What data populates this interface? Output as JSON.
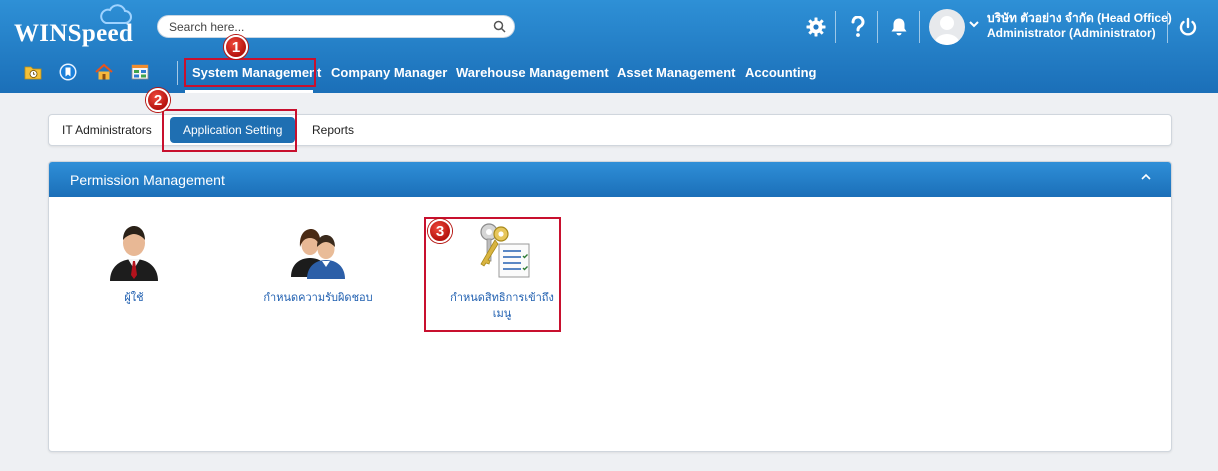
{
  "app": {
    "logo_text": "WINSpeed"
  },
  "search": {
    "placeholder": "Search here..."
  },
  "header": {
    "company": "บริษัท ตัวอย่าง จำกัด (Head Office)",
    "user": "Administrator (Administrator)",
    "icons": [
      "gear-icon",
      "help-icon",
      "bell-icon",
      "avatar",
      "power-icon"
    ]
  },
  "nav": {
    "quick_icons": [
      "folder-clock-icon",
      "bookmark-icon",
      "home-icon",
      "dashboard-icon"
    ],
    "items": [
      {
        "label": "System Management",
        "active": true
      },
      {
        "label": "Company Manager"
      },
      {
        "label": "Warehouse Management"
      },
      {
        "label": "Asset Management"
      },
      {
        "label": "Accounting"
      }
    ]
  },
  "tabs": [
    {
      "label": "IT Administrators"
    },
    {
      "label": "Application Setting",
      "active": true
    },
    {
      "label": "Reports"
    }
  ],
  "panel": {
    "title": "Permission Management",
    "tiles": [
      {
        "label": "ผู้ใช้",
        "icon": "user-icon"
      },
      {
        "label": "กำหนดความรับผิดชอบ",
        "icon": "users-group-icon"
      },
      {
        "label": "กำหนดสิทธิการเข้าถึงเมนู",
        "label_line1": "กำหนดสิทธิการเข้าถึง",
        "label_line2": "เมนู",
        "icon": "keys-checklist-icon"
      }
    ]
  },
  "annotations": {
    "step1": "1",
    "step2": "2",
    "step3": "3"
  },
  "colors": {
    "header_blue": "#1b6fb8",
    "active_tab": "#1f6fb2",
    "highlight_red": "#c8102e",
    "link_blue": "#1f5fb0"
  }
}
